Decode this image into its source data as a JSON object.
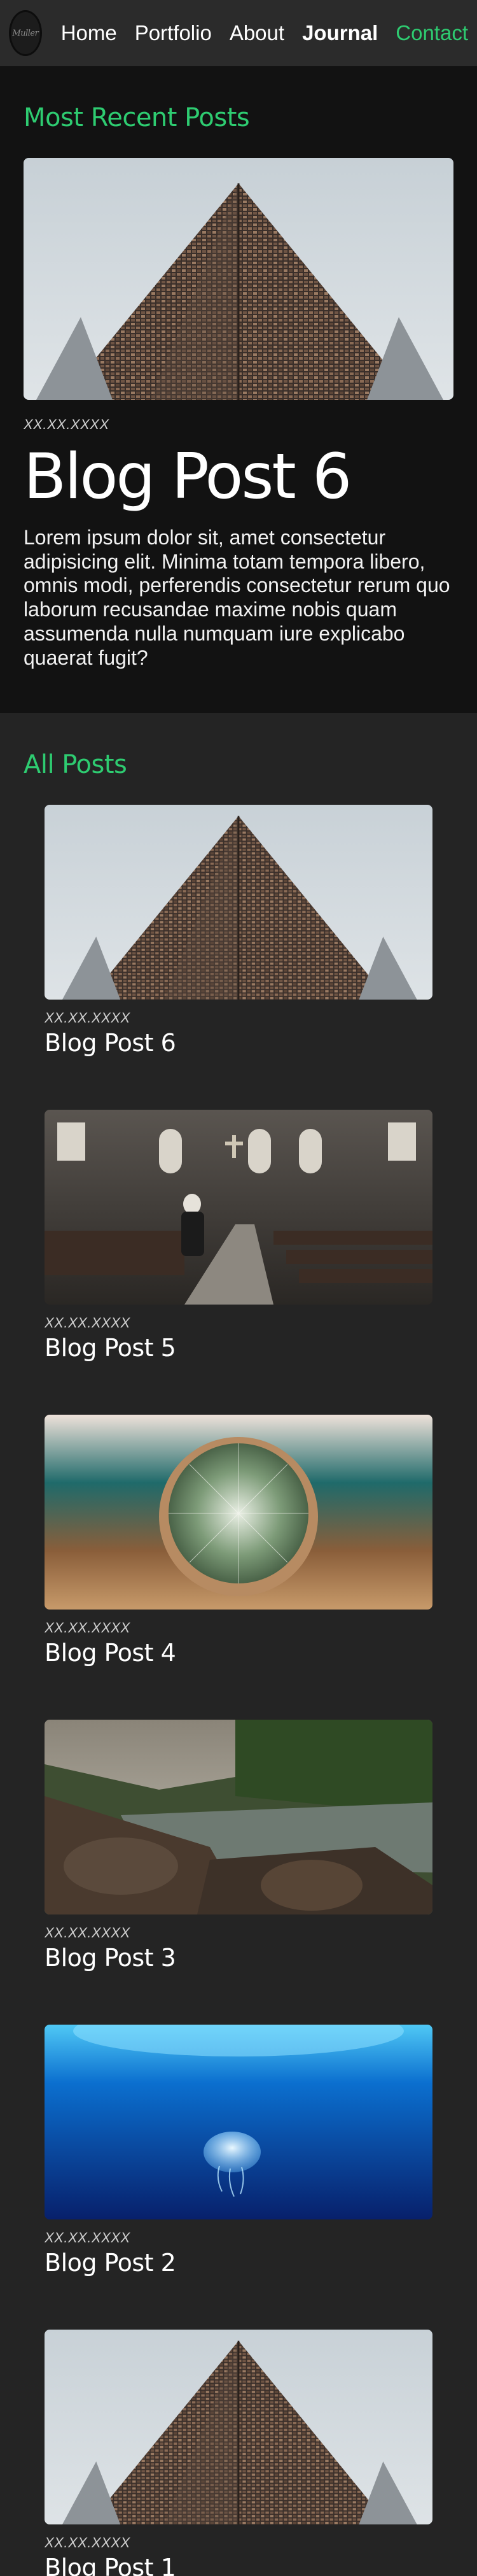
{
  "nav": {
    "logo_text": "Muller",
    "links": [
      {
        "label": "Home"
      },
      {
        "label": "Portfolio"
      },
      {
        "label": "About"
      },
      {
        "label": "Journal"
      },
      {
        "label": "Contact"
      }
    ]
  },
  "recent": {
    "heading": "Most Recent Posts",
    "date": "XX.XX.XXXX",
    "title": "Blog Post 6",
    "excerpt": "Lorem ipsum dolor sit, amet consectetur adipisicing elit. Minima totam tempora libero, omnis modi, perferendis consectetur rerum quo laborum recusandae maxime nobis quam assumenda nulla numquam iure explicabo quaerat fugit?",
    "image": "building-photo"
  },
  "all": {
    "heading": "All Posts",
    "posts": [
      {
        "date": "XX.XX.XXXX",
        "title": "Blog Post 6",
        "image": "building-photo"
      },
      {
        "date": "XX.XX.XXXX",
        "title": "Blog Post 5",
        "image": "church-photo"
      },
      {
        "date": "XX.XX.XXXX",
        "title": "Blog Post 4",
        "image": "cactus-photo"
      },
      {
        "date": "XX.XX.XXXX",
        "title": "Blog Post 3",
        "image": "river-photo"
      },
      {
        "date": "XX.XX.XXXX",
        "title": "Blog Post 2",
        "image": "jellyfish-photo"
      },
      {
        "date": "XX.XX.XXXX",
        "title": "Blog Post 1",
        "image": "building-photo"
      }
    ]
  },
  "colors": {
    "accent": "#2ecc71",
    "nav_bg": "#2b2b2b",
    "recent_bg": "#121212",
    "page_bg": "#242424"
  }
}
